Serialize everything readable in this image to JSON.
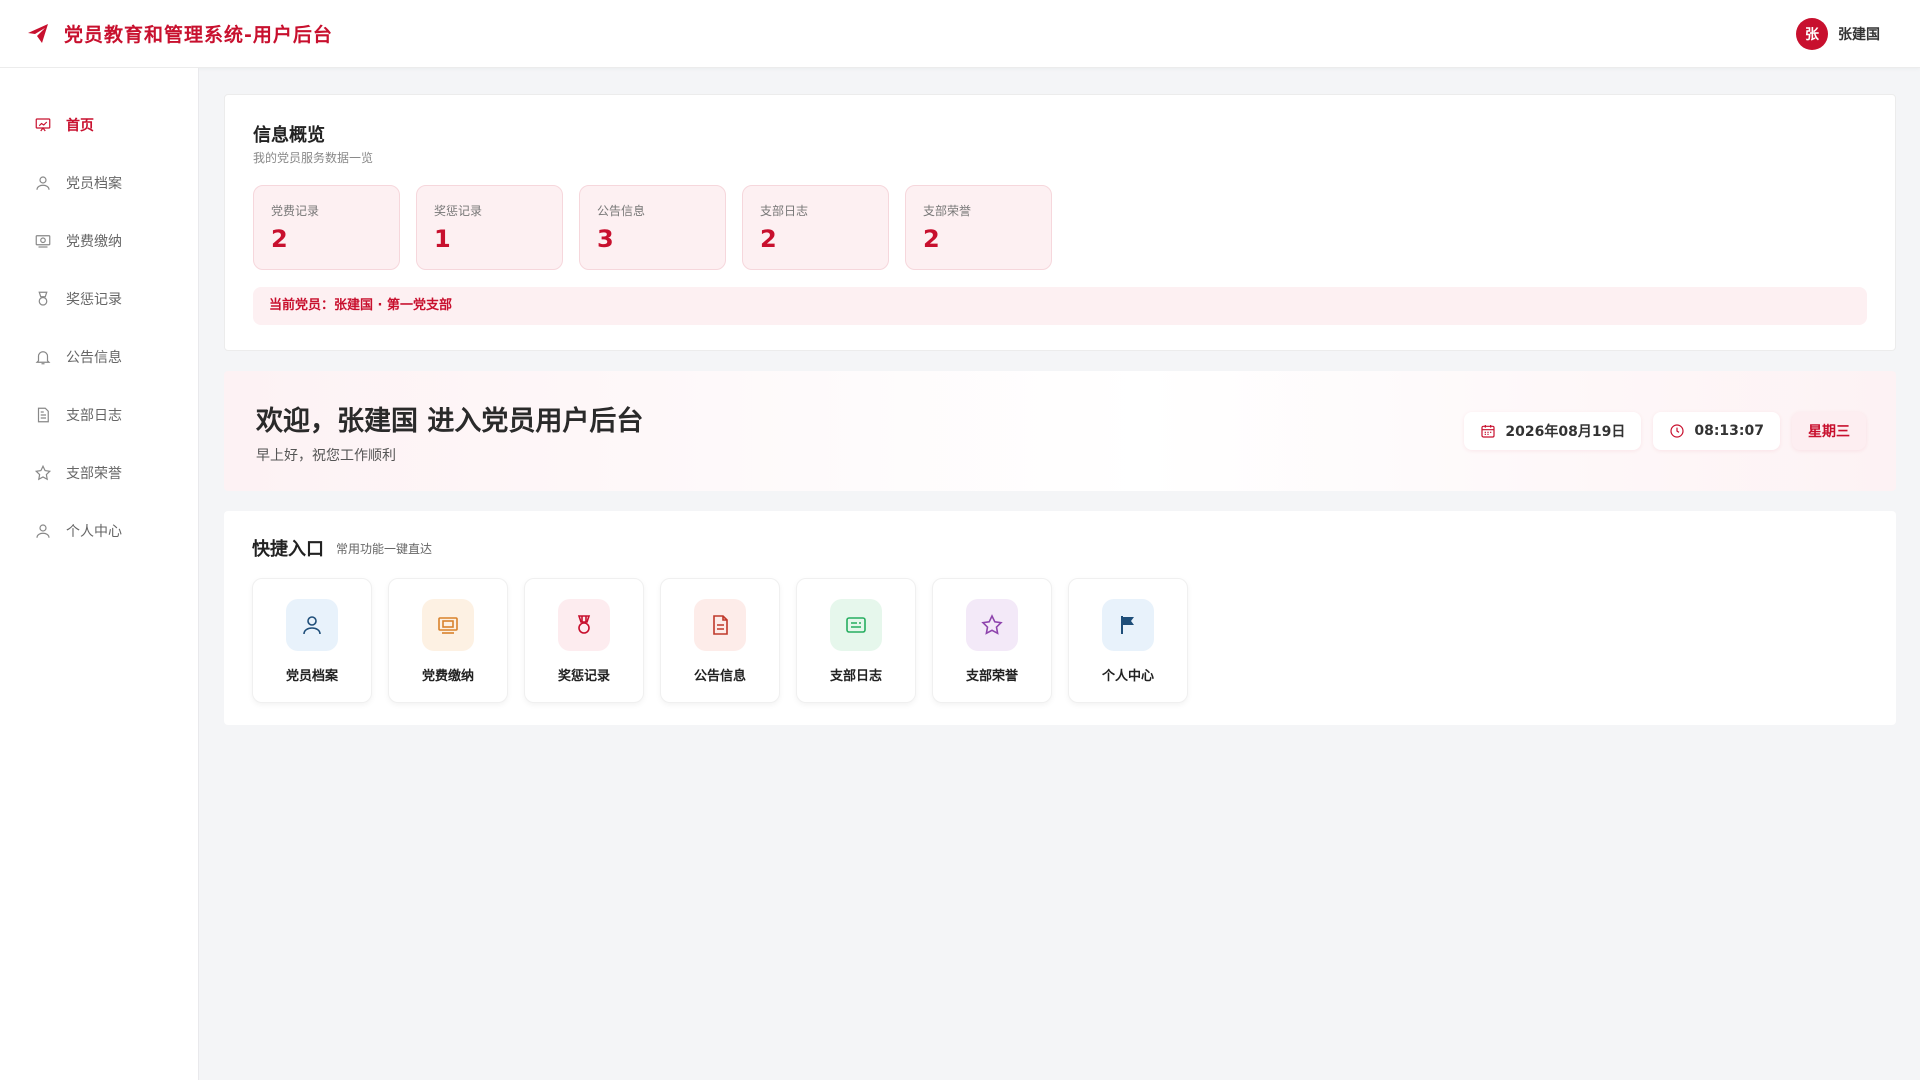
{
  "header": {
    "title": "党员教育和管理系统-用户后台",
    "brand_icon": "paper-plane-icon"
  },
  "user": {
    "avatar_char": "张",
    "name": "张建国"
  },
  "sidebar": {
    "items": [
      {
        "label": "首页",
        "icon": "presentation-chart-icon",
        "active": true
      },
      {
        "label": "党员档案",
        "icon": "user-icon"
      },
      {
        "label": "党费缴纳",
        "icon": "money-icon"
      },
      {
        "label": "奖惩记录",
        "icon": "medal-icon"
      },
      {
        "label": "公告信息",
        "icon": "bell-icon"
      },
      {
        "label": "支部日志",
        "icon": "document-icon"
      },
      {
        "label": "支部荣誉",
        "icon": "star-icon"
      },
      {
        "label": "个人中心",
        "icon": "user-icon"
      }
    ]
  },
  "overview": {
    "title": "信息概览",
    "subtitle": "我的党员服务数据一览",
    "stats": [
      {
        "label": "党费记录",
        "value": "2"
      },
      {
        "label": "奖惩记录",
        "value": "1"
      },
      {
        "label": "公告信息",
        "value": "3"
      },
      {
        "label": "支部日志",
        "value": "2"
      },
      {
        "label": "支部荣誉",
        "value": "2"
      }
    ],
    "current_member": "当前党员：张建国 · 第一党支部"
  },
  "welcome": {
    "title": "欢迎，张建国 进入党员用户后台",
    "subtitle": "早上好，祝您工作顺利",
    "date": "2026年08月19日",
    "time": "08:13:07",
    "weekday": "星期三"
  },
  "quick": {
    "title": "快捷入口",
    "subtitle": "常用功能一键直达",
    "tiles": [
      {
        "label": "党员档案",
        "icon": "user-icon",
        "color": "#1e4e79",
        "bg": "#e8f2fb"
      },
      {
        "label": "党费缴纳",
        "icon": "money-icon",
        "color": "#d9822b",
        "bg": "#fdf1e3"
      },
      {
        "label": "奖惩记录",
        "icon": "medal-icon",
        "color": "#c8102e",
        "bg": "#fdecef"
      },
      {
        "label": "公告信息",
        "icon": "document-icon",
        "color": "#c0392b",
        "bg": "#fdece9"
      },
      {
        "label": "支部日志",
        "icon": "id-card-icon",
        "color": "#27ae60",
        "bg": "#e6f7ec"
      },
      {
        "label": "支部荣誉",
        "icon": "star-icon",
        "color": "#8e44ad",
        "bg": "#f3e9f8"
      },
      {
        "label": "个人中心",
        "icon": "flag-icon",
        "color": "#1e4e79",
        "bg": "#e8f2fb"
      }
    ]
  },
  "colors": {
    "accent": "#c8102e",
    "background": "#f4f5f7"
  }
}
